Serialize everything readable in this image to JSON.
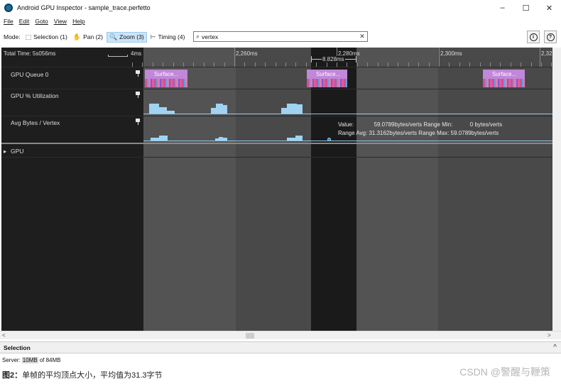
{
  "window": {
    "title": "Android GPU Inspector - sample_trace.perfetto",
    "minimize": "–",
    "maximize": "☐",
    "close": "✕"
  },
  "menu": [
    "File",
    "Edit",
    "Goto",
    "View",
    "Help"
  ],
  "toolbar": {
    "mode_label": "Mode:",
    "modes": [
      {
        "label": "Selection (1)",
        "icon": "selection-icon",
        "glyph": "⬚",
        "active": false
      },
      {
        "label": "Pan (2)",
        "icon": "hand-icon",
        "glyph": "✋",
        "active": false
      },
      {
        "label": "Zoom (3)",
        "icon": "zoom-icon",
        "glyph": "🔍",
        "active": true
      },
      {
        "label": "Timing (4)",
        "icon": "timing-icon",
        "glyph": "⊢",
        "active": false
      }
    ],
    "search_value": "vertex",
    "search_glyph": "⌕",
    "clear_glyph": "✕",
    "info_glyph": "i",
    "help_glyph": "?"
  },
  "timeline": {
    "total_time": "Total Time: 5s056ms",
    "scale_label": "4ms",
    "ticks": [
      "2,260ms",
      "2,280ms",
      "2,300ms",
      "2,32"
    ],
    "measure": "8.828ms",
    "tracks": [
      {
        "label": "GPU Queue 0",
        "pinned": true
      },
      {
        "label": "GPU % Utilization",
        "pinned": true
      },
      {
        "label": "Avg Bytes / Vertex",
        "pinned": true
      }
    ],
    "group": {
      "label": "GPU",
      "glyph": "▸"
    },
    "slice_label": "Surface...",
    "utilization": [
      {
        "start": 0.08,
        "end": 0.22,
        "level": 0.62
      },
      {
        "start": 0.22,
        "end": 0.33,
        "level": 0.42
      },
      {
        "start": 0.33,
        "end": 0.44,
        "level": 0.18
      },
      {
        "start": 0.95,
        "end": 1.02,
        "level": 0.38
      },
      {
        "start": 1.02,
        "end": 1.12,
        "level": 0.62
      },
      {
        "start": 1.12,
        "end": 1.18,
        "level": 0.55
      },
      {
        "start": 1.94,
        "end": 2.02,
        "level": 0.35
      },
      {
        "start": 2.02,
        "end": 2.16,
        "level": 0.62
      },
      {
        "start": 2.16,
        "end": 2.24,
        "level": 0.58
      }
    ],
    "bytes_per_vertex": [
      {
        "start": 0.1,
        "end": 0.22,
        "level": 0.18
      },
      {
        "start": 0.22,
        "end": 0.34,
        "level": 0.3
      },
      {
        "start": 1.01,
        "end": 1.06,
        "level": 0.14
      },
      {
        "start": 1.06,
        "end": 1.12,
        "level": 0.22
      },
      {
        "start": 1.12,
        "end": 1.18,
        "level": 0.2
      },
      {
        "start": 2.02,
        "end": 2.14,
        "level": 0.2
      },
      {
        "start": 2.14,
        "end": 2.24,
        "level": 0.3
      }
    ],
    "tooltip": {
      "value_label": "Value:",
      "value": "59.0789bytes/verts",
      "range_min_label": "Range Min:",
      "range_min": "0 bytes/verts",
      "range_avg_label": "Range Avg:",
      "range_avg": "31.3162bytes/verts",
      "range_max_label": "Range Max:",
      "range_max": "59.0789bytes/verts"
    }
  },
  "scroll": {
    "left": "<",
    "right": ">"
  },
  "selection": {
    "title": "Selection",
    "toggle": "^"
  },
  "status": {
    "prefix": "Server:",
    "memory": "10MB",
    "suffix": "of 84MB"
  },
  "caption": {
    "figure": "图2：",
    "text": "单帧的平均顶点大小，平均值为31.3字节"
  },
  "watermark": "CSDN @警醒与鞭策"
}
